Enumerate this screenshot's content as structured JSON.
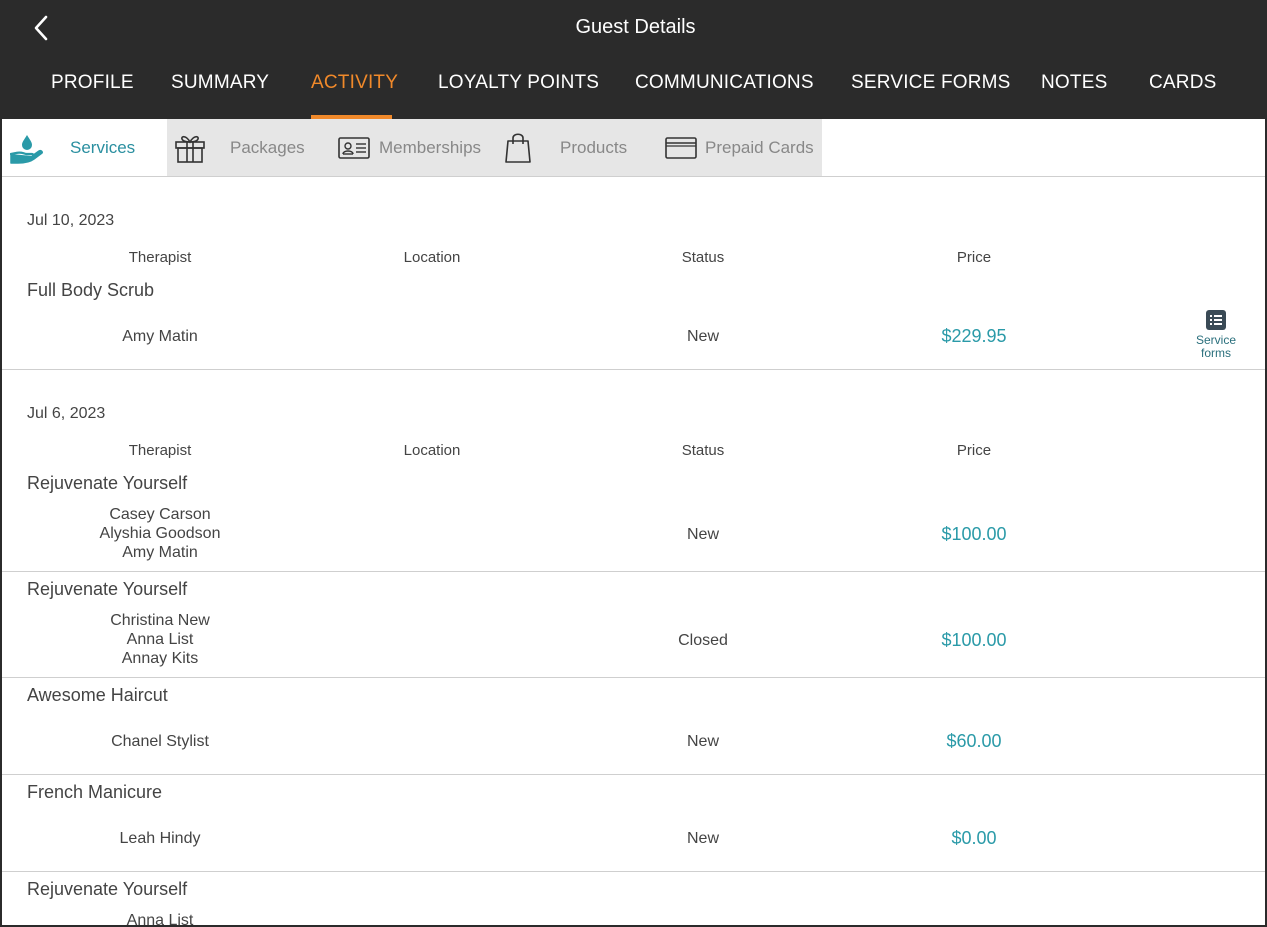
{
  "header": {
    "title": "Guest Details",
    "tabs": [
      {
        "label": "PROFILE"
      },
      {
        "label": "SUMMARY"
      },
      {
        "label": "ACTIVITY"
      },
      {
        "label": "LOYALTY POINTS"
      },
      {
        "label": "COMMUNICATIONS"
      },
      {
        "label": "SERVICE FORMS"
      },
      {
        "label": "NOTES"
      },
      {
        "label": "CARDS"
      }
    ],
    "active_tab": "ACTIVITY"
  },
  "subtabs": [
    {
      "label": "Services",
      "icon": "hand-drop-icon"
    },
    {
      "label": "Packages",
      "icon": "gift-icon"
    },
    {
      "label": "Memberships",
      "icon": "id-card-icon"
    },
    {
      "label": "Products",
      "icon": "shopping-bag-icon"
    },
    {
      "label": "Prepaid Cards",
      "icon": "credit-card-icon"
    }
  ],
  "columns": {
    "therapist": "Therapist",
    "location": "Location",
    "status": "Status",
    "price": "Price"
  },
  "sections": [
    {
      "date": "Jul 10, 2023",
      "items": [
        {
          "name": "Full Body Scrub",
          "therapists": [
            "Amy Matin"
          ],
          "status": "New",
          "price": "$229.95",
          "forms_label_1": "Service",
          "forms_label_2": "forms"
        }
      ]
    },
    {
      "date": "Jul 6, 2023",
      "items": [
        {
          "name": "Rejuvenate Yourself",
          "therapists": [
            "Casey Carson",
            "Alyshia Goodson",
            "Amy Matin"
          ],
          "status": "New",
          "price": "$100.00"
        },
        {
          "name": "Rejuvenate Yourself",
          "therapists": [
            "Christina New",
            "Anna List",
            "Annay Kits"
          ],
          "status": "Closed",
          "price": "$100.00"
        },
        {
          "name": "Awesome Haircut",
          "therapists": [
            "Chanel Stylist"
          ],
          "status": "New",
          "price": "$60.00"
        },
        {
          "name": "French Manicure",
          "therapists": [
            "Leah Hindy"
          ],
          "status": "New",
          "price": "$0.00"
        },
        {
          "name": "Rejuvenate Yourself",
          "therapists": [
            "Anna List"
          ],
          "status": "",
          "price": ""
        }
      ]
    }
  ],
  "colors": {
    "header_bg": "#2b2b2b",
    "accent": "#f0892a",
    "teal": "#2a9aa8"
  }
}
